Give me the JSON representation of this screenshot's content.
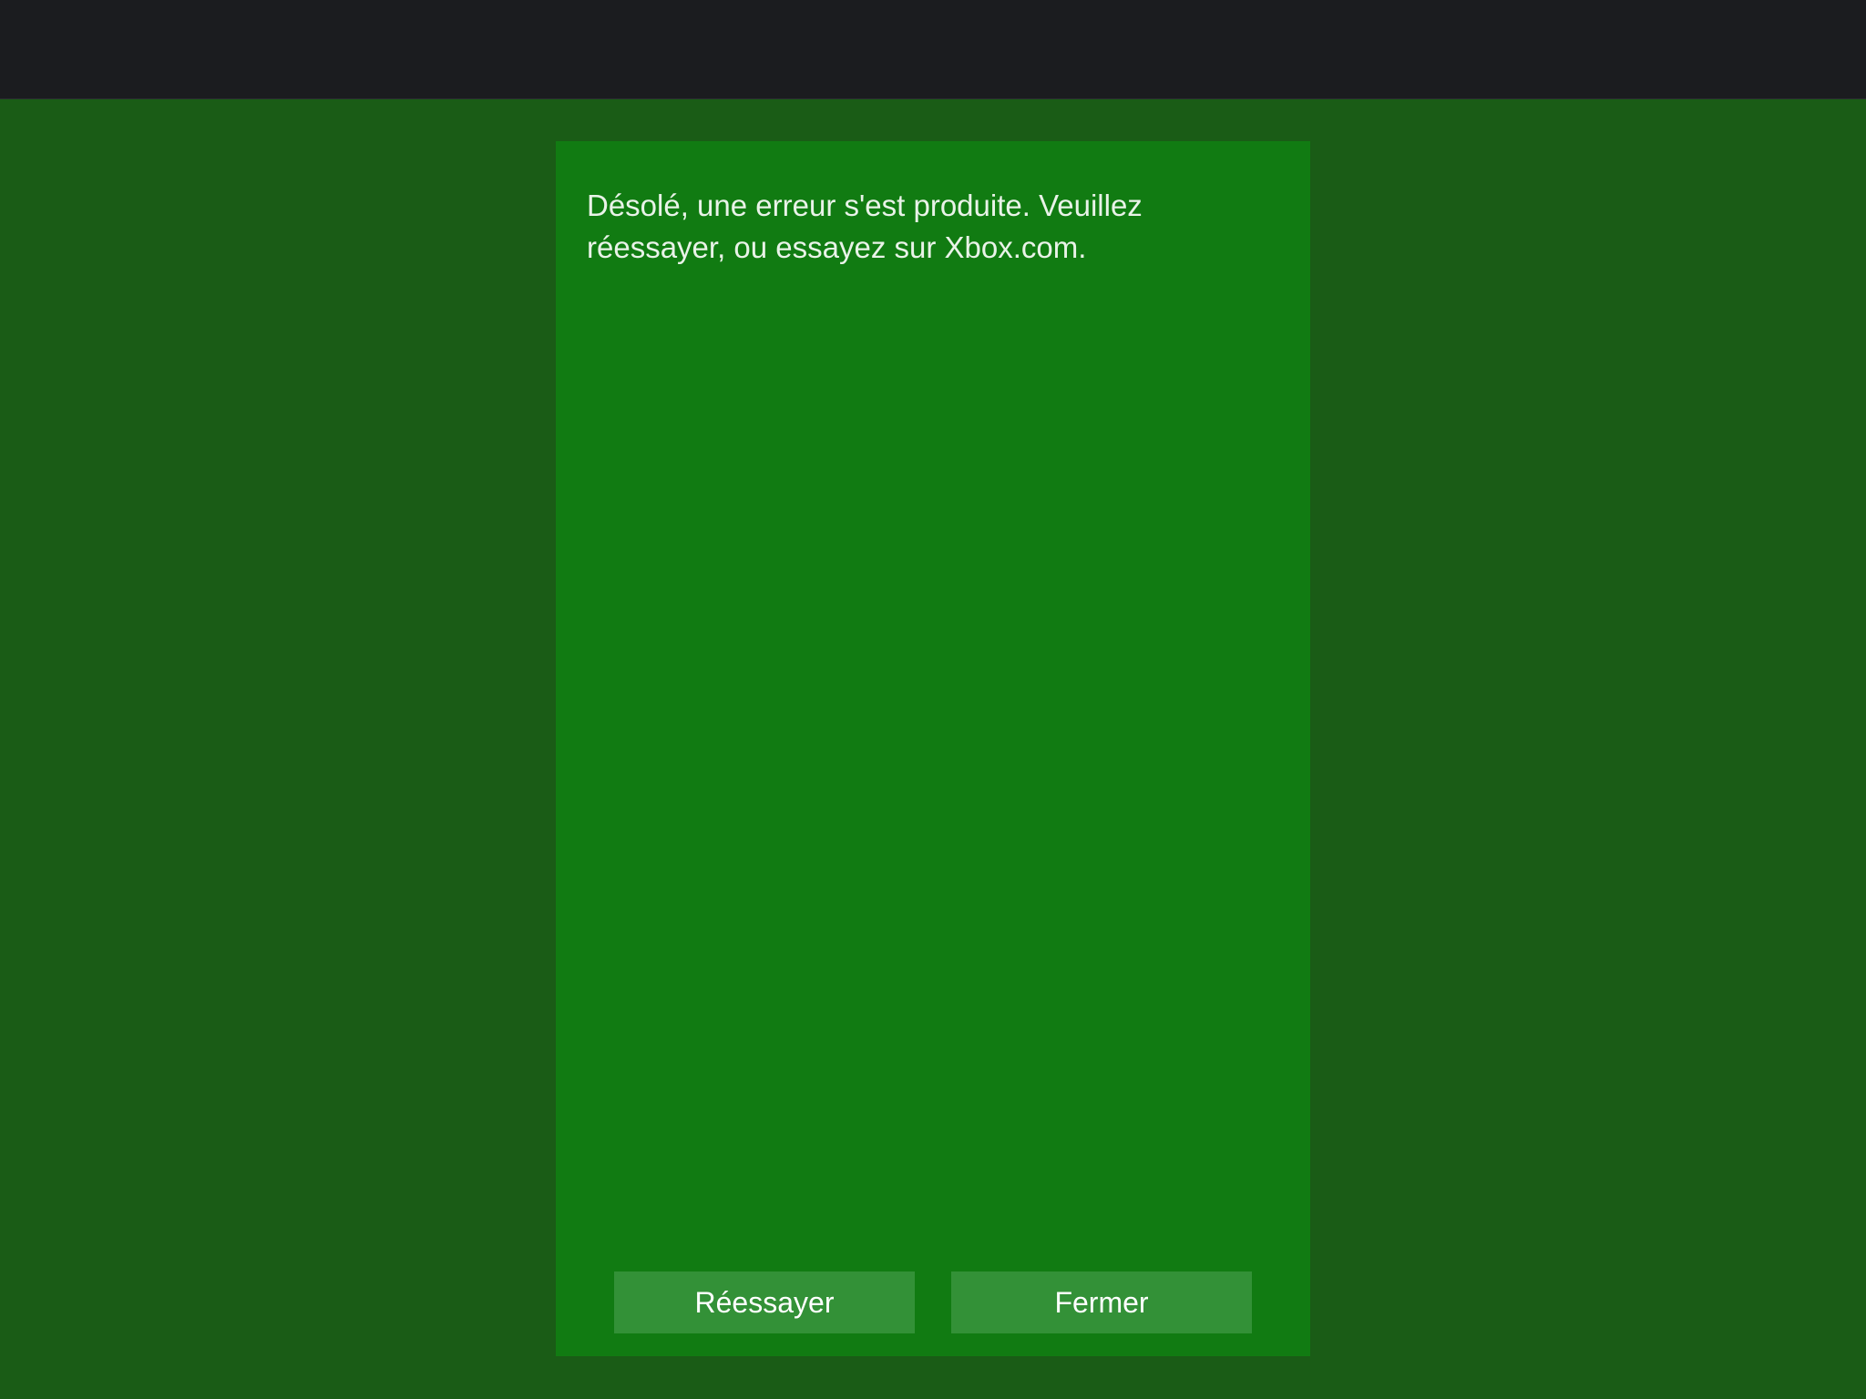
{
  "dialog": {
    "message": "Désolé, une erreur s'est produite. Veuillez réessayer, ou essayez sur Xbox.com.",
    "retry_label": "Réessayer",
    "close_label": "Fermer"
  },
  "colors": {
    "top_bar": "#1b1c1f",
    "backdrop": "#1a5c16",
    "dialog_background": "#117b12",
    "button_background": "#339137",
    "text": "#e9f3e8"
  }
}
